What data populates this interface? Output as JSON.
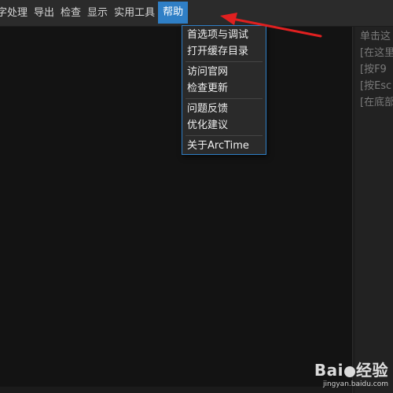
{
  "menubar": {
    "items": [
      "字处理",
      "导出",
      "检查",
      "显示",
      "实用工具"
    ],
    "active": "帮助"
  },
  "help_menu": {
    "groups": [
      [
        "首选项与调试",
        "打开缓存目录"
      ],
      [
        "访问官网",
        "检查更新"
      ],
      [
        "问题反馈",
        "优化建议"
      ],
      [
        "关于ArcTime"
      ]
    ]
  },
  "side_panel": {
    "lines": [
      "单击这",
      "[在这里",
      "[按F9",
      "[按Esc",
      "[在底部"
    ]
  },
  "watermark": {
    "logo_left": "Bai",
    "logo_right": "经验",
    "site": "jingyan.baidu.com"
  },
  "colors": {
    "accent": "#2f7fc6",
    "annotation_arrow": "#e02020"
  }
}
